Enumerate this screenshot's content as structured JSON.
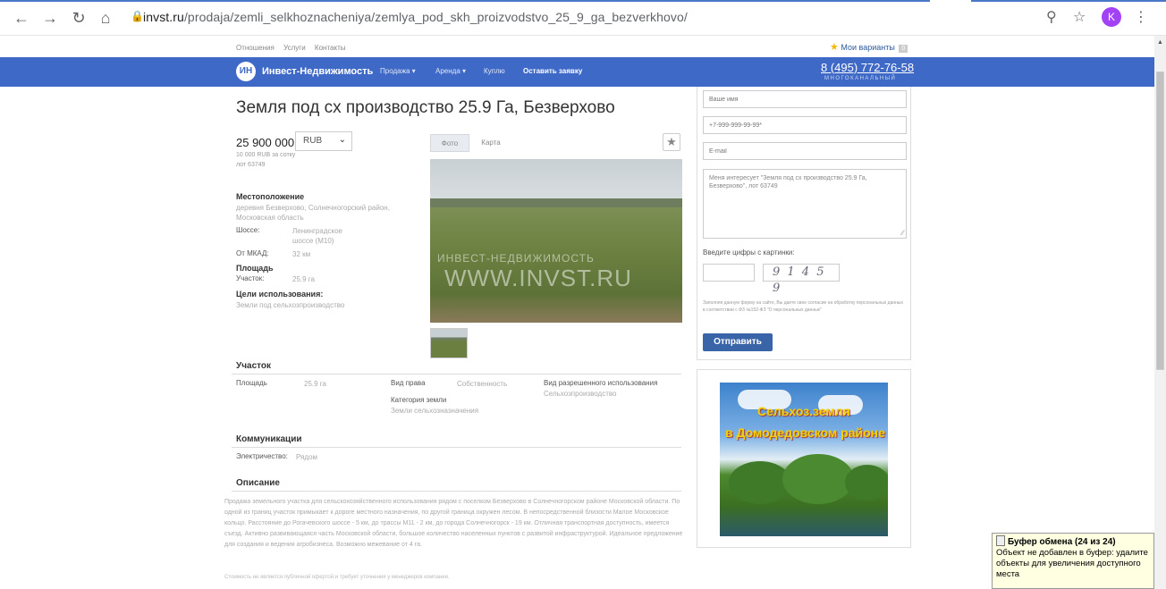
{
  "browser": {
    "url_host": "invst.ru",
    "url_path": "/prodaja/zemli_selkhoznacheniya/zemlya_pod_skh_proizvodstvo_25_9_ga_bezverkhovo/",
    "avatar_letter": "K"
  },
  "toplinks": [
    "Отношения",
    "Услуги",
    "Контакты"
  ],
  "my_variants": {
    "label": "Мои варианты",
    "count": "0"
  },
  "header": {
    "logo_mark": "ИН",
    "brand": "Инвест-Недвижимость",
    "nav": [
      "Продажа",
      "Аренда",
      "Куплю"
    ],
    "cta": "Оставить заявку",
    "phone": "8 (495) 772-76-58",
    "phone_sub": "МНОГОКАНАЛЬНЫЙ"
  },
  "listing": {
    "title": "Земля под сх производство 25.9 Га, Безверхово",
    "price": "25 900 000",
    "currency": "RUB",
    "price_per_unit": "10 000 RUB за сотку",
    "lot": "лот 63749",
    "location_label": "Местоположение",
    "location_value": "деревня Безверхово, Солнечногорский район, Московская область",
    "highway_label": "Шоссе:",
    "highway_value": "Ленинградское шоссе (М10)",
    "mkad_label": "От МКАД:",
    "mkad_value": "32 км",
    "area_label": "Площадь",
    "plot_label": "Участок:",
    "plot_value": "25.9 га",
    "use_label": "Цели использования:",
    "use_value": "Земли под сельхозпроизводство"
  },
  "photo": {
    "tab_photo": "Фото",
    "tab_map": "Карта",
    "watermark_top": "ИНВЕСТ-НЕДВИЖИМОСТЬ",
    "watermark_main": "WWW.INVST.RU"
  },
  "section_plot": {
    "title": "Участок",
    "area_label": "Площадь",
    "area_value": "25.9 га",
    "right_label": "Вид права",
    "right_value": "Собственность",
    "permitted_label": "Вид разрешенного использования",
    "permitted_value": "Сельхозпроизводство",
    "category_label": "Категория земли",
    "category_value": "Земли сельхозназначения"
  },
  "section_comm": {
    "title": "Коммуникации",
    "electric_label": "Электричество:",
    "electric_value": "Рядом"
  },
  "section_desc": {
    "title": "Описание",
    "text": "Продажа земельного участка для сельскохозяйственного использования рядом с поселком Безверхово в Солнечногорском районе Московской области. По одной из границ участок примыкает к дороге местного назначения, по другой граница окружен лесом. В непосредственной близости Малое Московское кольцо. Расстояние до Рогачевского шоссе - 5 км, до трассы М11 - 2 км, до города Солнечногорск - 19 км. Отличная транспортная доступность, имеется съезд. Активно развивающаяся часть Московской области, большое количество населенных пунктов с развитой инфраструктурой. Идеальное предложение для создания и ведения агробизнеса. Возможно межевание от 4 га.",
    "footer": "Стоимость не является публичной офертой и требует уточнения у менеджеров компании."
  },
  "form": {
    "name_placeholder": "Ваше имя",
    "phone_placeholder": "+7-999-999-99-99*",
    "email_placeholder": "E-mail",
    "message": "Меня интересует \"Земля под сх производство 25.9 Га, Безверхово\", лот 63749",
    "captcha_label": "Введите цифры с картинки:",
    "captcha_text": "9 1 4 5 9",
    "consent": "Заполняя данную форму на сайте, Вы даете свое согласие на обработку персональных данных в соответствии с ФЗ №152-ФЗ \"О персональных данных\"",
    "submit": "Отправить"
  },
  "ad": {
    "line1": "Сельхоз.земля",
    "line2": "в Домодедовском районе"
  },
  "clipboard": {
    "title": "Буфер обмена (24 из 24)",
    "message": "Объект не добавлен в буфер: удалите объекты для увеличения доступного места"
  }
}
